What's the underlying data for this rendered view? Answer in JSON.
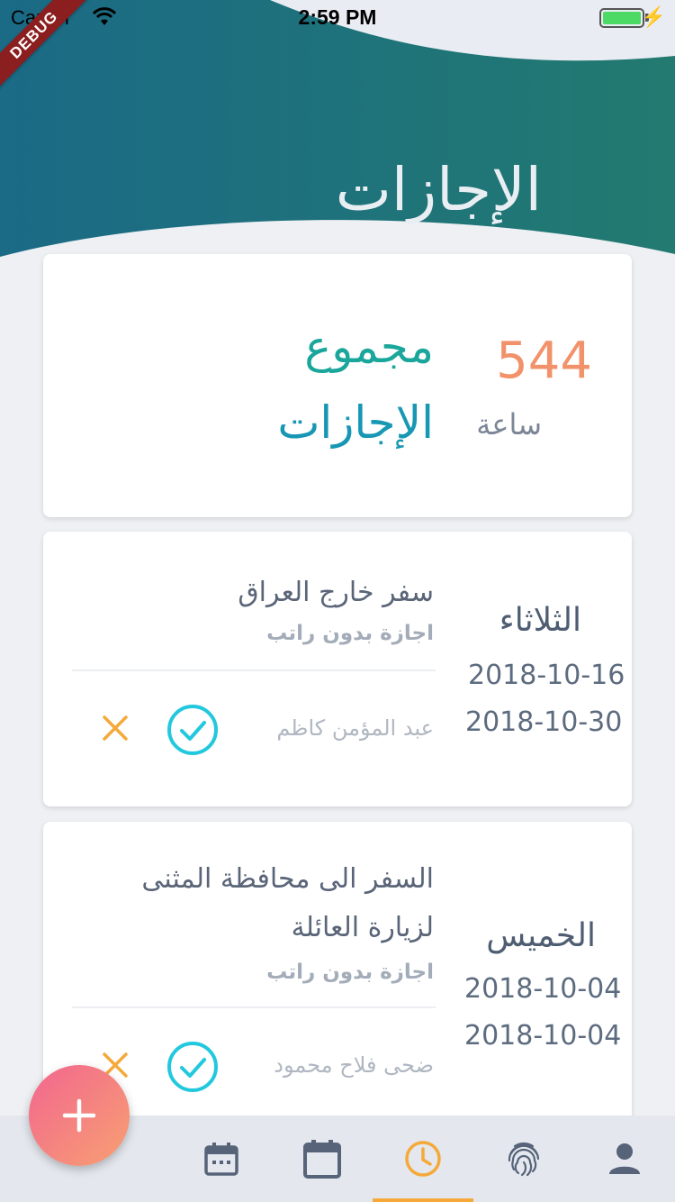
{
  "status_bar": {
    "carrier": "Carrier",
    "time": "2:59 PM",
    "battery_level": 1.0
  },
  "debug_banner": "DEBUG",
  "page": {
    "title": "الإجازات"
  },
  "summary": {
    "total_value": "544",
    "total_unit": "ساعة",
    "label_line1": "مجموع",
    "label_line2": "الإجازات"
  },
  "leaves": [
    {
      "day": "الثلاثاء",
      "start_date": "2018-10-16",
      "end_date": "2018-10-30",
      "reason": "سفر خارج العراق",
      "type": "اجازة بدون راتب",
      "employee": "عبد المؤمن كاظم"
    },
    {
      "day": "الخميس",
      "start_date": "2018-10-04",
      "end_date": "2018-10-04",
      "reason_line1": "السفر الى محافظة المثنى",
      "reason_line2": "لزيارة العائلة",
      "type": "اجازة بدون راتب",
      "employee": "ضحى فلاح محمود"
    }
  ],
  "bottom_nav": {
    "items": [
      {
        "icon": "calendar-grid-icon"
      },
      {
        "icon": "calendar-icon"
      },
      {
        "icon": "clock-icon",
        "active": true
      },
      {
        "icon": "fingerprint-icon"
      },
      {
        "icon": "person-icon"
      }
    ]
  },
  "colors": {
    "header_gradient_start": "#1d6d86",
    "header_gradient_end": "#217a6f",
    "accent_orange": "#f4a93a",
    "total_number": "#f2926a",
    "label_teal": "#1aa69a",
    "approve_cyan": "#22c8dd"
  }
}
